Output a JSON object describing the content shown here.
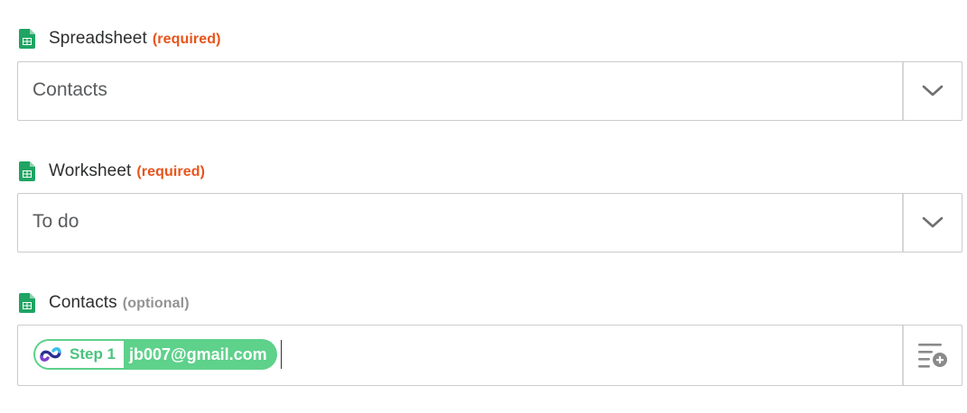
{
  "fields": [
    {
      "label": "Spreadsheet",
      "tag": "(required)",
      "value": "Contacts",
      "control": "dropdown"
    },
    {
      "label": "Worksheet",
      "tag": "(required)",
      "value": "To do",
      "control": "dropdown"
    },
    {
      "label": "Contacts",
      "tag": "(optional)",
      "control": "insert-data",
      "pill": {
        "step": "Step 1",
        "value": "jb007@gmail.com"
      }
    }
  ],
  "colors": {
    "required": "#e8541b",
    "optional": "#939393",
    "pill": "#5ed18b",
    "sheets_icon": "#1fa463"
  },
  "icons": {
    "field_icon": "google-sheets-icon",
    "dropdown_toggle": "chevron-down-icon",
    "insert_data": "insert-data-icon",
    "step_app": "step-app-logo-icon"
  }
}
